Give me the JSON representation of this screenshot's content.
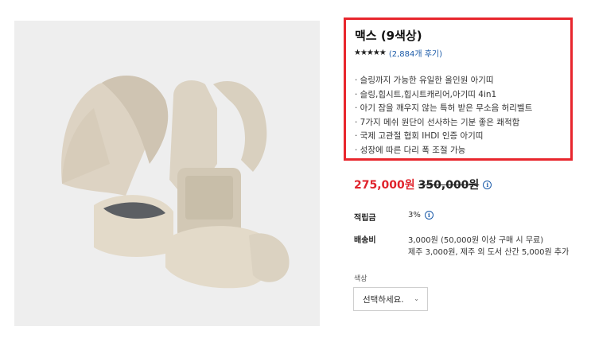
{
  "product": {
    "title": "맥스 (9색상)",
    "stars": "★★★★★",
    "review_count": "(2,884개 후기)",
    "features": [
      "· 슬링까지 가능한 유일한 올인원 아기띠",
      "· 슬링,힙시트,힙시트캐리어,아기띠 4in1",
      "· 아기 잠을 깨우지 않는 특허 받은 무소음 허리벨트",
      "· 7가지 메쉬 원단이 선사하는 기분 좋은 쾌적함",
      "· 국제 고관절 협회 IHDI 인증 아기띠",
      "· 성장에 따른 다리 폭 조절 가능"
    ],
    "sale_price": "275,000원",
    "original_price": "350,000원"
  },
  "details": {
    "points_label": "적립금",
    "points_value": "3%",
    "shipping_label": "배송비",
    "shipping_line1": "3,000원 (50,000원 이상 구매 시 무료)",
    "shipping_line2": "제주 3,000원, 제주 외 도서 산간 5,000원 추가"
  },
  "option": {
    "label": "색상",
    "selected": "선택하세요.",
    "chevron": "⌄"
  },
  "icons": {
    "info": "i"
  },
  "colors": {
    "highlight": "#e8262d",
    "sale": "#e0232c",
    "link": "#1a5aa8"
  }
}
